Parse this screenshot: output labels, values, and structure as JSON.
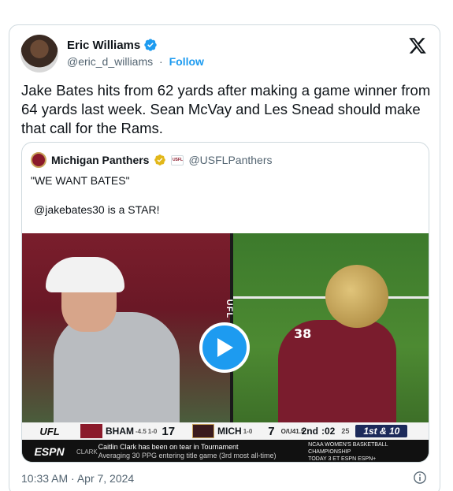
{
  "author": {
    "name": "Eric Williams",
    "handle": "@eric_d_williams",
    "separator": "·",
    "follow_label": "Follow"
  },
  "tweet": {
    "text": "Jake Bates hits from 62 yards after making a game winner from 64 yards last week. Sean McVay and Les Snead should make that call for the Rams.",
    "timestamp": "10:33 AM · Apr 7, 2024"
  },
  "quote": {
    "name": "Michigan Panthers",
    "badge_text": "USFL",
    "handle": "@USFLPanthers",
    "line1": "\"WE WANT BATES\"",
    "line2": "@jakebates30 is a STAR!"
  },
  "video": {
    "divider_text": "UFL",
    "jersey_number": "38",
    "scorebar": {
      "league": "UFL",
      "team1": "BHAM",
      "team1_spread": "-4.5",
      "team1_record": "1-0",
      "team1_score": "17",
      "team2": "MICH",
      "team2_record": "1-0",
      "team2_score": "7",
      "ou_label": "O/U",
      "ou_value": "41.5",
      "quarter": "2nd",
      "clock": ":02",
      "play_clock": "25",
      "down": "1st & 10"
    },
    "ticker": {
      "network": "ESPN",
      "tag": "CLARK",
      "headline": "Caitlin Clark has been on tear in Tournament",
      "sub": "Averaging 30 PPG entering title game (3rd most all-time)",
      "promo_line1": "NCAA WOMEN'S BASKETBALL CHAMPIONSHIP",
      "promo_line2": "TODAY 3 ET ESPN ESPN+"
    }
  },
  "colors": {
    "link": "#1d9bf0",
    "verified": "#1d9bf0",
    "gold_badge": "#e2b719",
    "text_primary": "#0f1419",
    "text_secondary": "#536471",
    "border": "#cfd9de"
  },
  "icons": [
    "verified-icon",
    "x-logo-icon",
    "gold-verified-icon",
    "play-icon",
    "info-icon"
  ]
}
